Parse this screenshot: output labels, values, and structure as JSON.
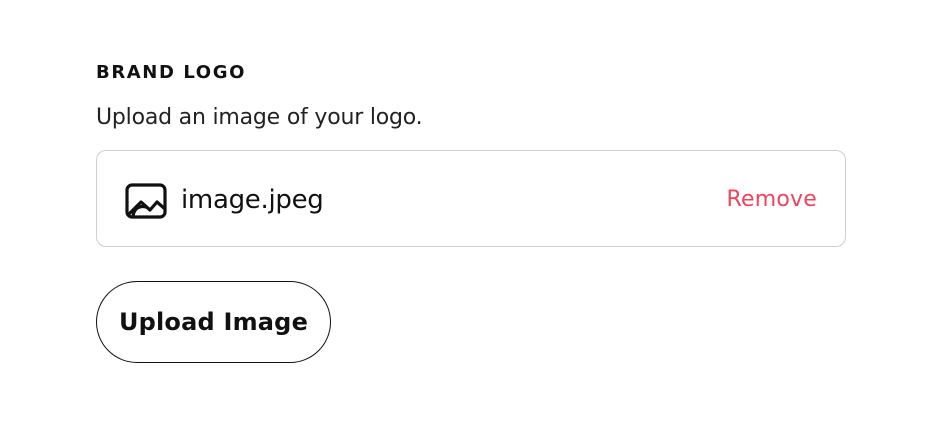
{
  "brand_logo": {
    "title": "BRAND LOGO",
    "description": "Upload an image of your logo.",
    "file": {
      "name": "image.jpeg",
      "icon": "image-icon",
      "remove_label": "Remove"
    },
    "upload_label": "Upload Image"
  },
  "colors": {
    "accent_remove": "#f0435e",
    "text": "#111111",
    "card_border": "#cfcfcf"
  }
}
